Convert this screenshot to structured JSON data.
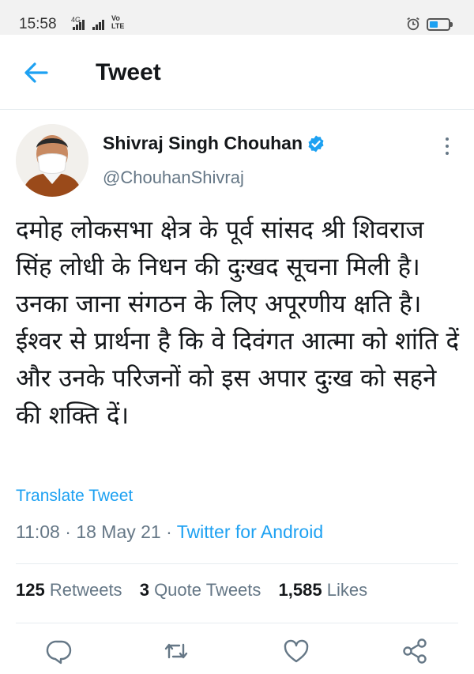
{
  "status_bar": {
    "time": "15:58",
    "network_label": "4G",
    "volte_top": "Vo",
    "volte_bottom": "LTE",
    "battery_color": "#1da1f2"
  },
  "header": {
    "title": "Tweet",
    "back_icon": "arrow-left-icon"
  },
  "tweet": {
    "author": {
      "display_name": "Shivraj Singh Chouhan",
      "username": "@ChouhanShivraj",
      "verified": true
    },
    "text": "दमोह लोकसभा क्षेत्र के पूर्व सांसद श्री शिवराज सिंह लोधी के निधन की दुःखद सूचना मिली है। उनका जाना संगठन के लिए अपूरणीय क्षति है। ईश्वर से प्रार्थना है कि वे दिवंगत आत्मा को शांति दें और उनके परिजनों को इस अपार दुःख को सहने की शक्ति दें।",
    "translate_label": "Translate Tweet",
    "time": "11:08",
    "date": "18 May 21",
    "separator": "·",
    "source": "Twitter for Android",
    "stats": {
      "retweets_count": "125",
      "retweets_label": "Retweets",
      "quotes_count": "3",
      "quotes_label": "Quote Tweets",
      "likes_count": "1,585",
      "likes_label": "Likes"
    }
  },
  "actions": [
    {
      "name": "reply",
      "icon": "comment-icon"
    },
    {
      "name": "retweet",
      "icon": "retweet-icon"
    },
    {
      "name": "like",
      "icon": "heart-icon"
    },
    {
      "name": "share",
      "icon": "share-icon"
    }
  ],
  "colors": {
    "accent": "#1da1f2",
    "secondary_text": "#657786",
    "primary_text": "#14171a"
  }
}
